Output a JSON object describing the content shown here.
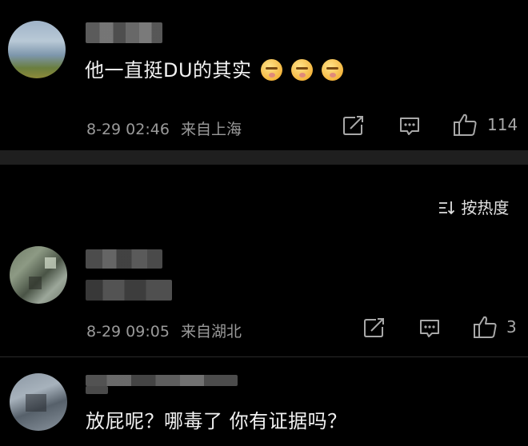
{
  "comments": [
    {
      "text": "他一直挺DU的其实",
      "emojis": [
        "shushing-face-emoji",
        "shushing-face-emoji",
        "shushing-face-emoji"
      ],
      "date_time": "8-29 02:46",
      "location": "来自上海",
      "likes": "114"
    },
    {
      "text": "",
      "date_time": "8-29 09:05",
      "location": "来自湖北",
      "likes": "3"
    },
    {
      "text": "放屁呢？哪毒了 你有证据吗？"
    }
  ],
  "sort": {
    "icon": "sort-icon",
    "label": "按热度"
  },
  "icons": {
    "share": "share-icon",
    "reply": "comment-icon",
    "like": "thumbs-up-icon"
  },
  "colors": {
    "background": "#000000",
    "text_primary": "#f2f2f2",
    "text_secondary": "#9a9a9a",
    "divider": "#2a2a2a"
  }
}
